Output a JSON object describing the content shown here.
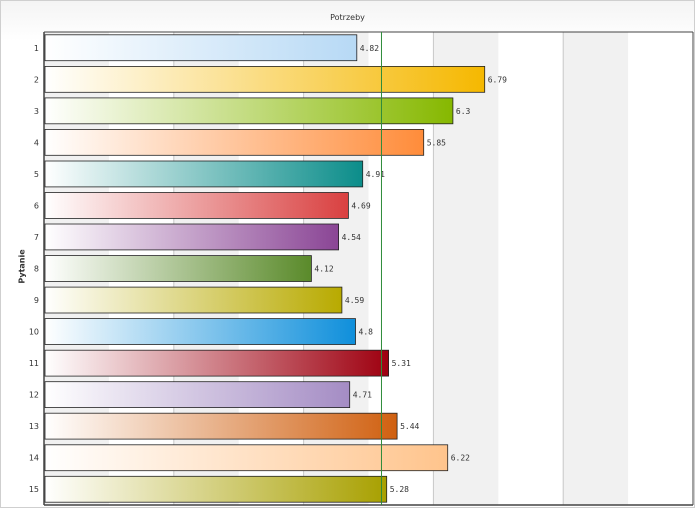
{
  "chart_data": {
    "type": "bar",
    "orientation": "horizontal",
    "title": "Potrzeby",
    "xlabel": "",
    "ylabel": "Pytanie",
    "categories": [
      "1",
      "2",
      "3",
      "4",
      "5",
      "6",
      "7",
      "8",
      "9",
      "10",
      "11",
      "12",
      "13",
      "14",
      "15"
    ],
    "values": [
      4.82,
      6.79,
      6.3,
      5.85,
      4.91,
      4.69,
      4.54,
      4.12,
      4.59,
      4.8,
      5.31,
      4.71,
      5.44,
      6.22,
      5.28
    ],
    "xlim": [
      0,
      10
    ],
    "bar_colors": [
      "#b7d9f5",
      "#f5b800",
      "#86b800",
      "#ff8c3a",
      "#0b8d8a",
      "#d94040",
      "#8a4595",
      "#5a8a2a",
      "#b8aa00",
      "#0f8fdb",
      "#9e0010",
      "#a48cc4",
      "#d06010",
      "#ffc48c",
      "#a8a000"
    ],
    "reference_line": 5.2,
    "reference_color": "#2e8b3a",
    "grid": true,
    "legend": "none"
  }
}
